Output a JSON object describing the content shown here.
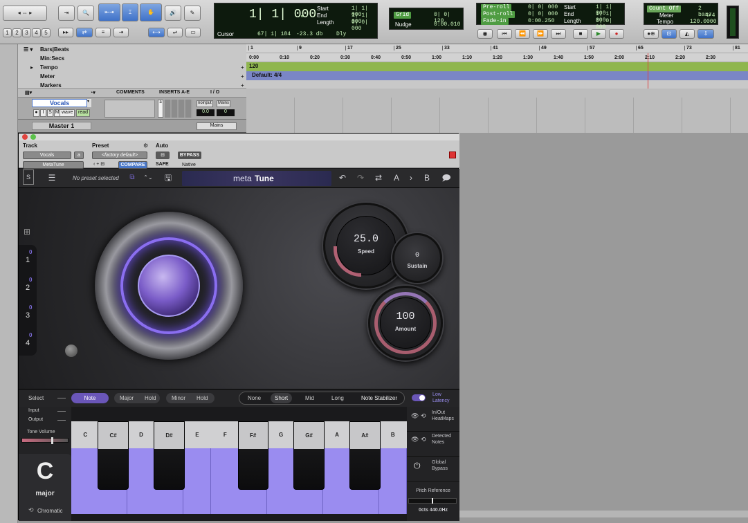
{
  "counter": {
    "main": "1| 1| 000",
    "cursor_label": "Cursor",
    "cursor_value": "67| 1| 184",
    "db_value": "-23.3 db",
    "dly_label": "Dly",
    "start_label": "Start",
    "end_label": "End",
    "length_label": "Length",
    "start_value": "1| 1| 000",
    "end_value": "1| 1| 000",
    "length_value": "0| 0| 000",
    "grid_label": "Grid",
    "grid_value": "0| 0| 120",
    "nudge_label": "Nudge",
    "nudge_value": "0:00.010"
  },
  "transport_lcd": {
    "preroll_label": "Pre-roll",
    "postroll_label": "Post-roll",
    "fadein_label": "Fade-in",
    "preroll_value": "0| 0| 000",
    "postroll_value": "0| 0| 000",
    "fadein_value": "0:00.250",
    "start_label": "Start",
    "end_label": "End",
    "length_label": "Length",
    "start_value": "1| 1| 000",
    "end_value": "1| 1| 000",
    "length_value": "0| 0| 000"
  },
  "count_lcd": {
    "count_off": "Count Off",
    "bars": "2 bars",
    "meter_label": "Meter",
    "meter_value": "4/4",
    "tempo_label": "Tempo",
    "tempo_value": "120.0000"
  },
  "edit_buttons": [
    "1",
    "2",
    "3",
    "4",
    "5"
  ],
  "rulers": {
    "barsbeats": "Bars|Beats",
    "minsecs": "Min:Secs",
    "tempo": "Tempo",
    "meter": "Meter",
    "markers": "Markers",
    "bar_ticks": [
      "1",
      "9",
      "17",
      "25",
      "33",
      "41",
      "49",
      "57",
      "65",
      "73",
      "81"
    ],
    "time_ticks": [
      "0:00",
      "0:10",
      "0:20",
      "0:30",
      "0:40",
      "0:50",
      "1:00",
      "1:10",
      "1:20",
      "1:30",
      "1:40",
      "1:50",
      "2:00",
      "2:10",
      "2:20",
      "2:30"
    ],
    "tempo_value": "120",
    "meter_value": "Default: 4/4"
  },
  "mix_header": {
    "comments": "COMMENTS",
    "inserts": "INSERTS A-E",
    "io": "I / O"
  },
  "tracks": {
    "vocals_name": "Vocals",
    "vocals_buttons": [
      "I",
      "S",
      "M"
    ],
    "wave_label": "wave",
    "read_label": "read",
    "noinput": "noinput",
    "mains": "Mains",
    "pan_left": "0.0",
    "pan_right": "0",
    "master_name": "Master 1",
    "master_out": "Mains"
  },
  "plugin_header": {
    "track_label": "Track",
    "preset_label": "Preset",
    "auto_label": "Auto",
    "track_value": "Vocals",
    "plugin_value": "MetaTune",
    "insert_letter": "a",
    "preset_value": "<factory default>",
    "compare": "COMPARE",
    "safe": "SAFE",
    "bypass": "BYPASS",
    "native": "Native"
  },
  "plugin_toolbar": {
    "preset_text": "No preset selected",
    "brand_meta": "meta",
    "brand_tune": "Tune",
    "ab_a": "A",
    "ab_b": "B"
  },
  "sidebar_slots": [
    {
      "num": "1",
      "badge": "0"
    },
    {
      "num": "2",
      "badge": "0"
    },
    {
      "num": "3",
      "badge": "0"
    },
    {
      "num": "4",
      "badge": "0"
    }
  ],
  "knobs": {
    "speed_value": "25.0",
    "speed_label": "Speed",
    "sustain_value": "0",
    "sustain_label": "Sustain",
    "amount_value": "100",
    "amount_label": "Amount"
  },
  "control_bar": {
    "select_label": "Select",
    "note": "Note",
    "major": "Major",
    "hold1": "Hold",
    "minor": "Minor",
    "hold2": "Hold",
    "none": "None",
    "short": "Short",
    "mid": "Mid",
    "long": "Long",
    "note_stabilizer": "Note Stabilizer",
    "low_latency": "Low Latency"
  },
  "keyboard": {
    "input_label": "Input",
    "output_label": "Output",
    "tone_volume": "Tone Volume",
    "key": "C",
    "scale": "major",
    "chromatic": "Chromatic",
    "white_keys": [
      "C",
      "D",
      "E",
      "F",
      "G",
      "A",
      "B"
    ],
    "black_keys": [
      "C#",
      "D#",
      "F#",
      "G#",
      "A#"
    ]
  },
  "right_panel": {
    "heatmaps": "In/Out HeatMaps",
    "detected": "Detected Notes",
    "global_bypass": "Global Bypass",
    "pitch_ref": "Pitch Reference",
    "pitch_value": "0cts  440.0Hz"
  },
  "colors": {
    "accent_purple": "#6a56b8",
    "key_purple": "#9a8cf0",
    "tempo_green": "#8fb64e",
    "meter_blue": "#7a86c6",
    "lcd_bg": "#0d1a0d"
  }
}
